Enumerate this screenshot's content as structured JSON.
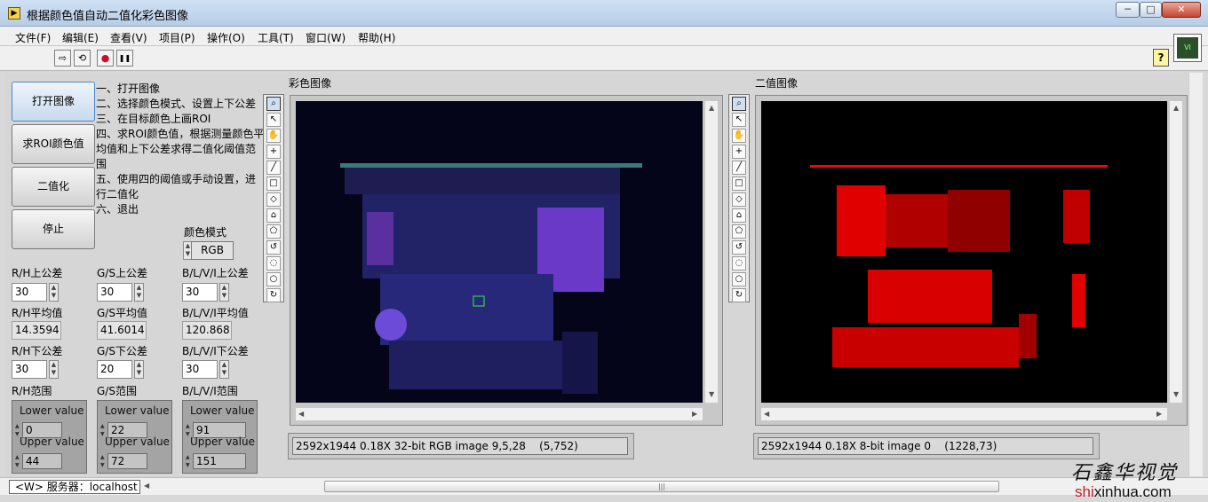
{
  "window": {
    "title": "根据颜色值自动二值化彩色图像",
    "min": "─",
    "max": "□",
    "close": "✕"
  },
  "menu": [
    "文件(F)",
    "编辑(E)",
    "查看(V)",
    "项目(P)",
    "操作(O)",
    "工具(T)",
    "窗口(W)",
    "帮助(H)"
  ],
  "toolbar": {
    "run": "⇨",
    "run_cont": "⟲",
    "abort": "●",
    "pause": "❚❚",
    "help": "?"
  },
  "buttons": {
    "open": "打开图像",
    "roi": "求ROI颜色值",
    "binarize": "二值化",
    "stop": "停止"
  },
  "instructions": [
    "一、打开图像",
    "二、选择颜色模式、设置上下公差",
    "三、在目标颜色上画ROI",
    "四、求ROI颜色值，根据测量颜色平均值和上下公差求得二值化阈值范围",
    "五、使用四的阈值或手动设置，进行二值化",
    "六、退出"
  ],
  "color_mode": {
    "label": "颜色模式",
    "value": "RGB"
  },
  "channels": [
    {
      "upper_label": "R/H上公差",
      "upper": "30",
      "mean_label": "R/H平均值",
      "mean": "14.3594",
      "lower_label": "R/H下公差",
      "lower": "30",
      "range_label": "R/H范围",
      "lower_value": "0",
      "upper_value": "44"
    },
    {
      "upper_label": "G/S上公差",
      "upper": "30",
      "mean_label": "G/S平均值",
      "mean": "41.6014",
      "lower_label": "G/S下公差",
      "lower": "20",
      "range_label": "G/S范围",
      "lower_value": "22",
      "upper_value": "72"
    },
    {
      "upper_label": "B/L/V/I上公差",
      "upper": "30",
      "mean_label": "B/L/V/I平均值",
      "mean": "120.868",
      "lower_label": "B/L/V/I下公差",
      "lower": "30",
      "range_label": "B/L/V/I范围",
      "lower_value": "91",
      "upper_value": "151"
    }
  ],
  "range_sub": {
    "lower": "Lower value",
    "upper": "Upper value"
  },
  "color_image": {
    "label": "彩色图像",
    "status": "2592x1944 0.18X 32-bit RGB image 9,5,28    (5,752)"
  },
  "binary_image": {
    "label": "二值图像",
    "status": "2592x1944 0.18X 8-bit image 0    (1228,73)"
  },
  "palette_tools": [
    "⌕",
    "↖",
    "✋",
    "+",
    "╱",
    "□",
    "◇",
    "⌂",
    "⬠",
    "↺",
    "◌",
    "○",
    "↻"
  ],
  "server": "<W> 服务器：localhost",
  "scroll_grip": "|||",
  "watermark": {
    "name": "石鑫华视觉",
    "url_red": "shi",
    "url_rest": "xinhua.com"
  },
  "colors": {
    "accent": "#4a87c8",
    "binary_fg": "#ff0000",
    "pcb": "#2a2a7a"
  }
}
